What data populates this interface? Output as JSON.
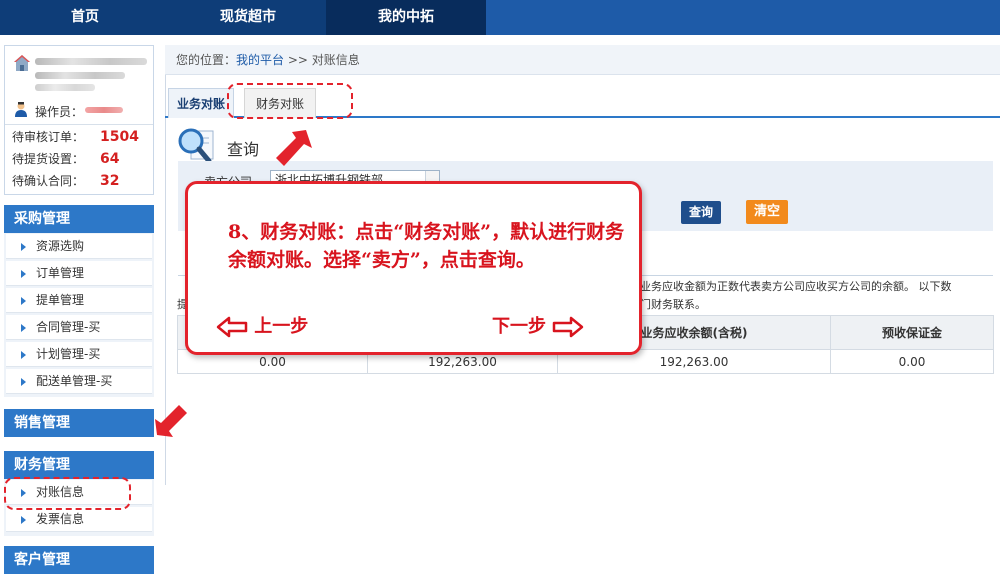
{
  "topnav": {
    "items": [
      "首页",
      "现货超市",
      "我的中拓"
    ]
  },
  "user": {
    "operator_label": "操作员：",
    "stats": [
      {
        "label": "待审核订单：",
        "value": "1504"
      },
      {
        "label": "待提货设置：",
        "value": "64"
      },
      {
        "label": "待确认合同：",
        "value": "32"
      }
    ]
  },
  "sidebar": {
    "purchase": {
      "title": "采购管理",
      "items": [
        "资源选购",
        "订单管理",
        "提单管理",
        "合同管理-买",
        "计划管理-买",
        "配送单管理-买"
      ]
    },
    "sales": {
      "title": "销售管理"
    },
    "finance": {
      "title": "财务管理",
      "items": [
        "对账信息",
        "发票信息"
      ]
    },
    "customer": {
      "title": "客户管理"
    }
  },
  "breadcrumb": {
    "prefix": "您的位置：",
    "link": "我的平台",
    "sep": " >> ",
    "current": "对账信息"
  },
  "tabs": [
    "业务对账",
    "财务对账"
  ],
  "query": {
    "title": "查询",
    "seller_label": "卖方公司",
    "seller_value": "浙北中拓博升钢铁部",
    "query_button": "查询",
    "clear_button": "清空"
  },
  "note": {
    "right": "业务应收金额为正数代表卖方公司应收买方公司的余额。 以下数",
    "right2": "门财务联系。",
    "left": "提"
  },
  "table": {
    "headers": [
      "",
      "",
      "业务应收余额(含税)",
      "预收保证金"
    ],
    "rows": [
      [
        "0.00",
        "192,263.00",
        "192,263.00",
        "0.00"
      ]
    ]
  },
  "callout": {
    "text": "8、财务对账：点击“财务对账”，默认进行财务余额对账。选择“卖方”，点击查询。",
    "prev": "上一步",
    "next": "下一步"
  },
  "colors": {
    "nav_bg": "#0e3d78",
    "accent": "#2d78c8",
    "annotation_red": "#e3232c",
    "stat_red": "#d42020",
    "clear_orange": "#f28a1c"
  }
}
